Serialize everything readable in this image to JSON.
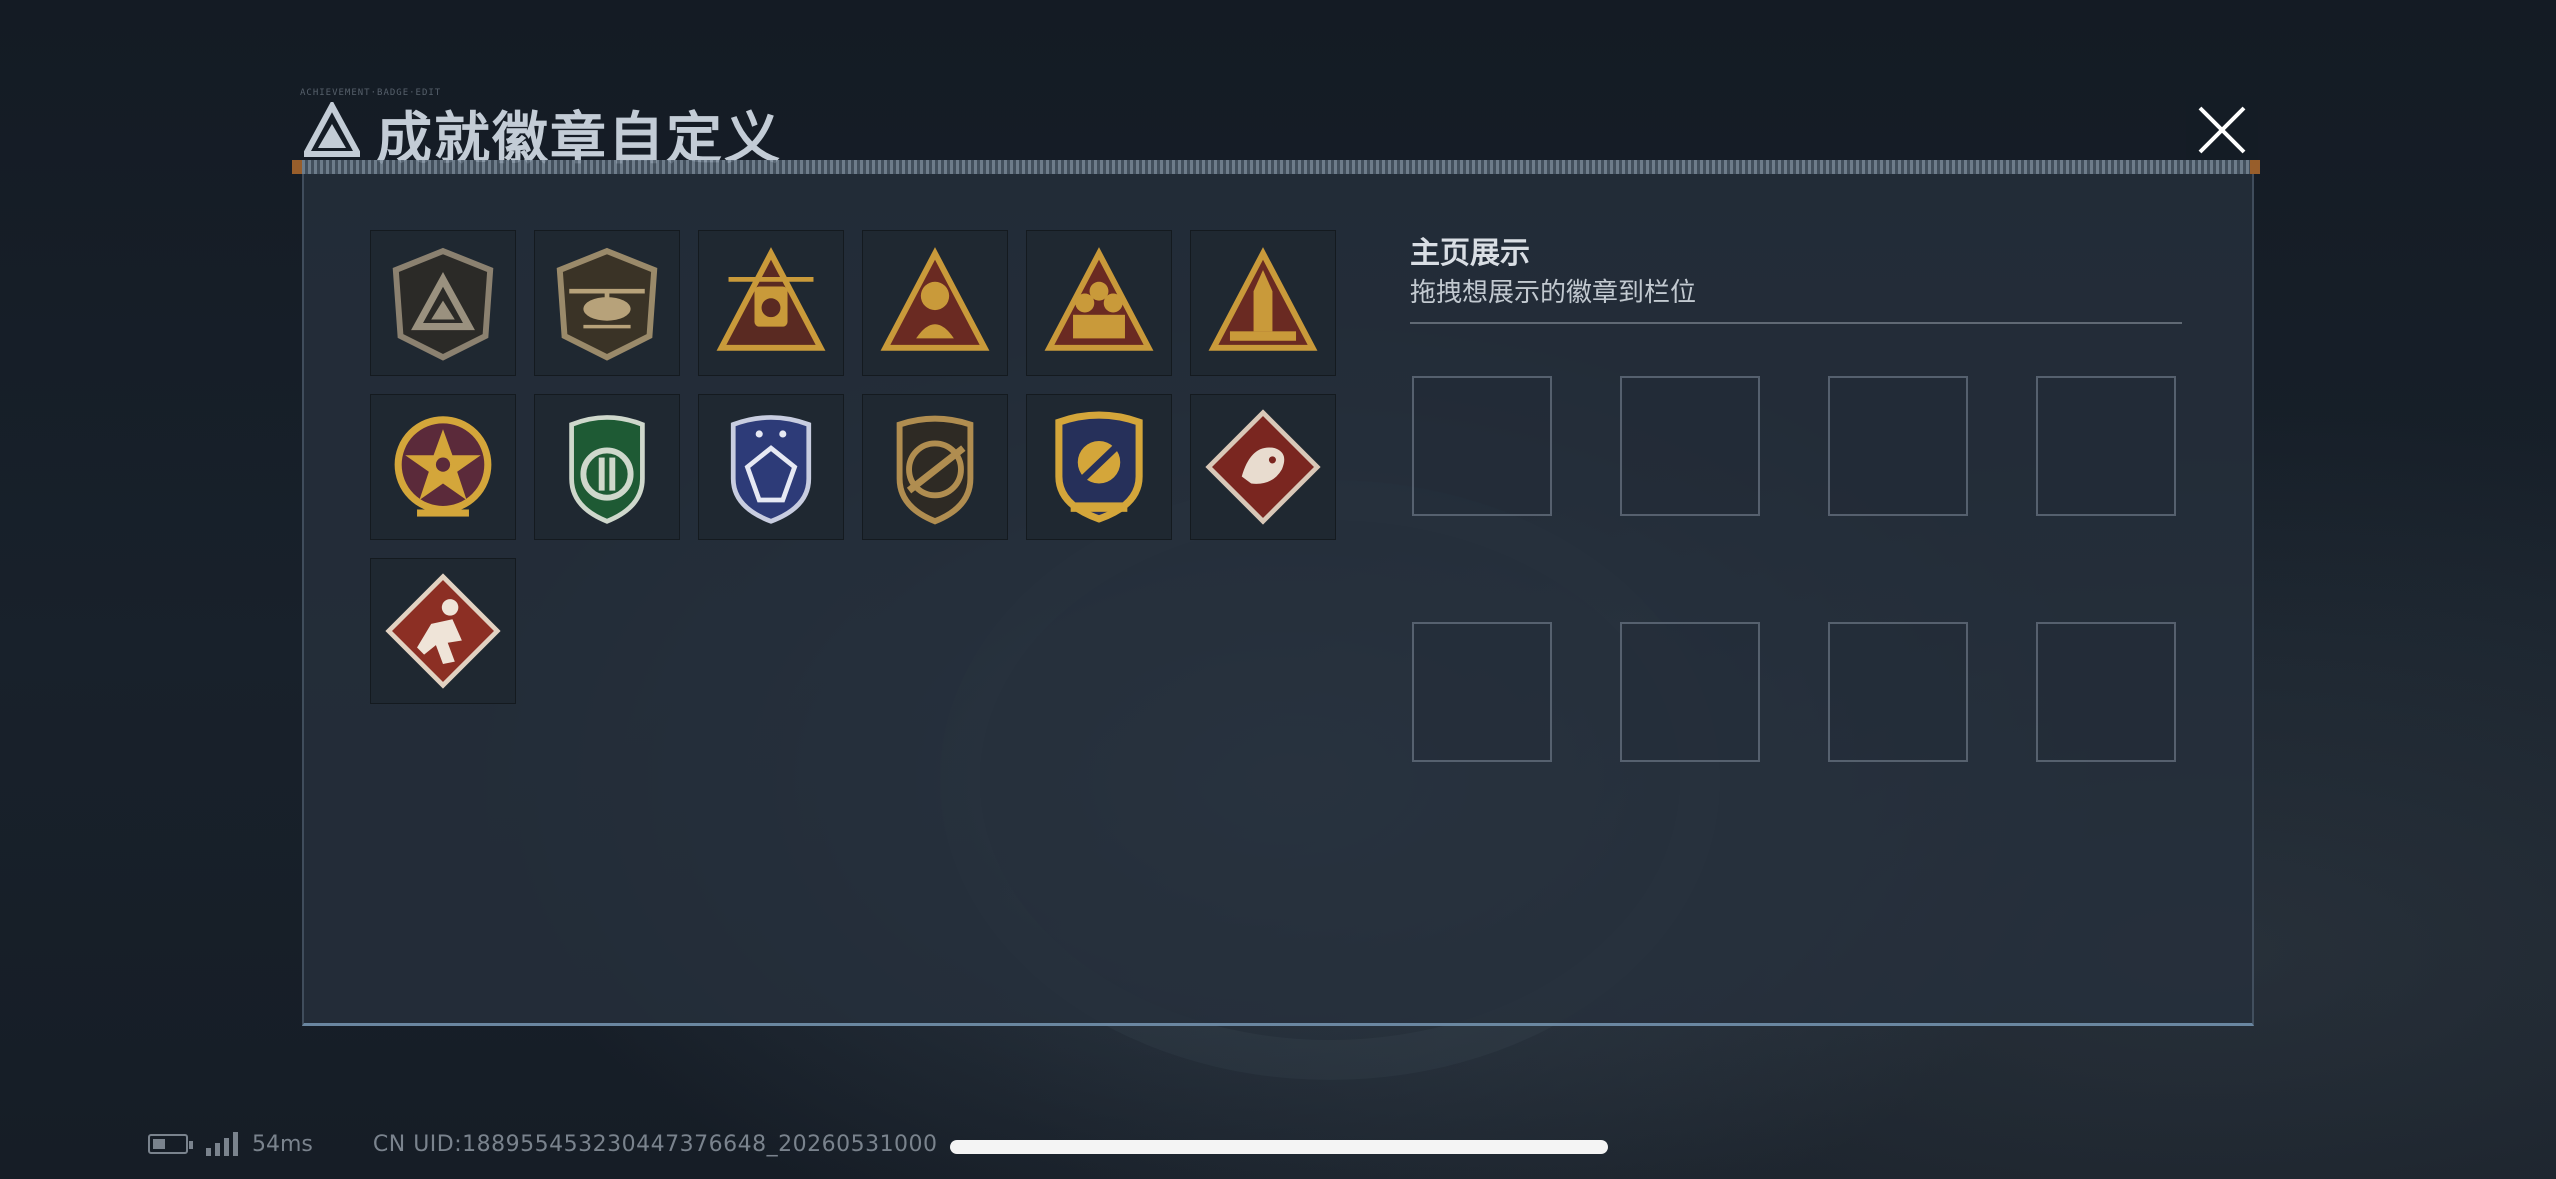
{
  "header": {
    "small_label": "ACHIEVEMENT·BADGE·EDIT",
    "title": "成就徽章自定义",
    "close_icon": "close-icon"
  },
  "badges": [
    {
      "icon": "faction-triangle-badge-icon",
      "color": "#8b8170"
    },
    {
      "icon": "helicopter-badge-icon",
      "color": "#9a8a6a"
    },
    {
      "icon": "robot-59-badge-icon",
      "color": "#c99a3a"
    },
    {
      "icon": "soldier-portrait-badge-icon",
      "color": "#c99a3a"
    },
    {
      "icon": "squad-badge-icon",
      "color": "#c99a3a"
    },
    {
      "icon": "missile-badge-icon",
      "color": "#c99a3a"
    },
    {
      "icon": "star-compass-badge-icon",
      "color": "#d4a63a"
    },
    {
      "icon": "green-shield-badge-icon",
      "color": "#3a7a4a"
    },
    {
      "icon": "blue-gem-badge-icon",
      "color": "#3d4f8c"
    },
    {
      "icon": "rifle-circle-badge-icon",
      "color": "#b08d50"
    },
    {
      "icon": "navy-crossed-badge-icon",
      "color": "#d4a63a"
    },
    {
      "icon": "dragon-badge-icon",
      "color": "#8a2e26"
    },
    {
      "icon": "runner-badge-icon",
      "color": "#9a3a2c"
    }
  ],
  "showcase": {
    "title": "主页展示",
    "subtitle": "拖拽想展示的徽章到栏位",
    "slot_count": 8
  },
  "status": {
    "ping": "54ms",
    "uid": "CN UID:1889554532304473766​48_20260531000"
  },
  "colors": {
    "gold": "#c99a3a",
    "panel_bg": "#26303c",
    "accent_line": "#82a5c3"
  }
}
